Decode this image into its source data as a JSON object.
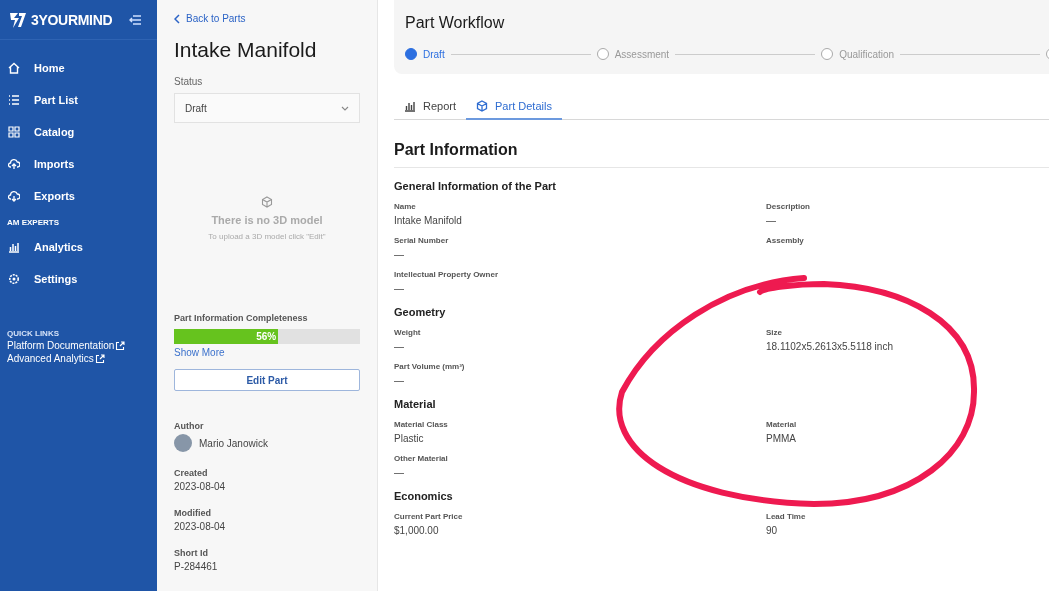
{
  "sidebar": {
    "logo": "3YOURMIND",
    "items": [
      {
        "label": "Home",
        "kind": "home"
      },
      {
        "label": "Part List",
        "kind": "list"
      },
      {
        "label": "Catalog",
        "kind": "grid"
      },
      {
        "label": "Imports",
        "kind": "upload"
      },
      {
        "label": "Exports",
        "kind": "download"
      }
    ],
    "section": "AM EXPERTS",
    "section_items": [
      {
        "label": "Analytics",
        "kind": "chart"
      },
      {
        "label": "Settings",
        "kind": "gear"
      }
    ],
    "quick_links_title": "QUICK LINKS",
    "quick_links": [
      "Platform Documentation",
      "Advanced Analytics"
    ]
  },
  "part": {
    "back": "Back to Parts",
    "title": "Intake Manifold",
    "status_label": "Status",
    "status_value": "Draft",
    "empty_title": "There is no 3D model",
    "empty_hint": "To upload a 3D model click \"Edit\"",
    "completeness_label": "Part Information Completeness",
    "completeness": {
      "level": 0.56,
      "text": "56%"
    },
    "show_more": "Show More",
    "edit_button": "Edit Part",
    "author_label": "Author",
    "author": "Mario Janowick",
    "meta": [
      {
        "label": "Created",
        "value": "2023-08-04"
      },
      {
        "label": "Modified",
        "value": "2023-08-04"
      },
      {
        "label": "Short Id",
        "value": "P-284461"
      }
    ]
  },
  "workflow": {
    "title": "Part Workflow",
    "steps": [
      {
        "label": "Draft",
        "selected": true
      },
      {
        "label": "Assessment",
        "selected": false
      },
      {
        "label": "Qualification",
        "selected": false
      },
      {
        "selected": false
      }
    ]
  },
  "tabs": [
    {
      "label": "Report",
      "kind": "chart",
      "selected": false
    },
    {
      "label": "Part Details",
      "kind": "cube",
      "selected": true
    }
  ],
  "info": {
    "title": "Part Information",
    "sections": [
      {
        "title": "General Information of the Part",
        "rows": [
          [
            {
              "label": "Name",
              "value": "Intake Manifold"
            },
            {
              "label": "Description",
              "value": "—"
            }
          ],
          [
            {
              "label": "Serial Number",
              "value": "—"
            },
            {
              "label": "Assembly"
            }
          ],
          [
            {
              "label": "Intellectual Property Owner",
              "value": "—"
            }
          ]
        ]
      },
      {
        "title": "Geometry",
        "rows": [
          [
            {
              "label": "Weight",
              "value": "—"
            },
            {
              "label": "Size",
              "value": "18.1102x5.2613x5.5118 inch"
            }
          ],
          [
            {
              "label": "Part Volume (mm³)",
              "value": "—"
            }
          ]
        ]
      },
      {
        "title": "Material",
        "rows": [
          [
            {
              "label": "Material Class",
              "value": "Plastic"
            },
            {
              "label": "Material",
              "value": "PMMA"
            }
          ],
          [
            {
              "label": "Other Material",
              "value": "—"
            }
          ]
        ]
      },
      {
        "title": "Economics",
        "rows": [
          [
            {
              "label": "Current Part Price",
              "value": "$1,000.00"
            },
            {
              "label": "Lead Time",
              "value": "90"
            }
          ]
        ]
      }
    ]
  }
}
